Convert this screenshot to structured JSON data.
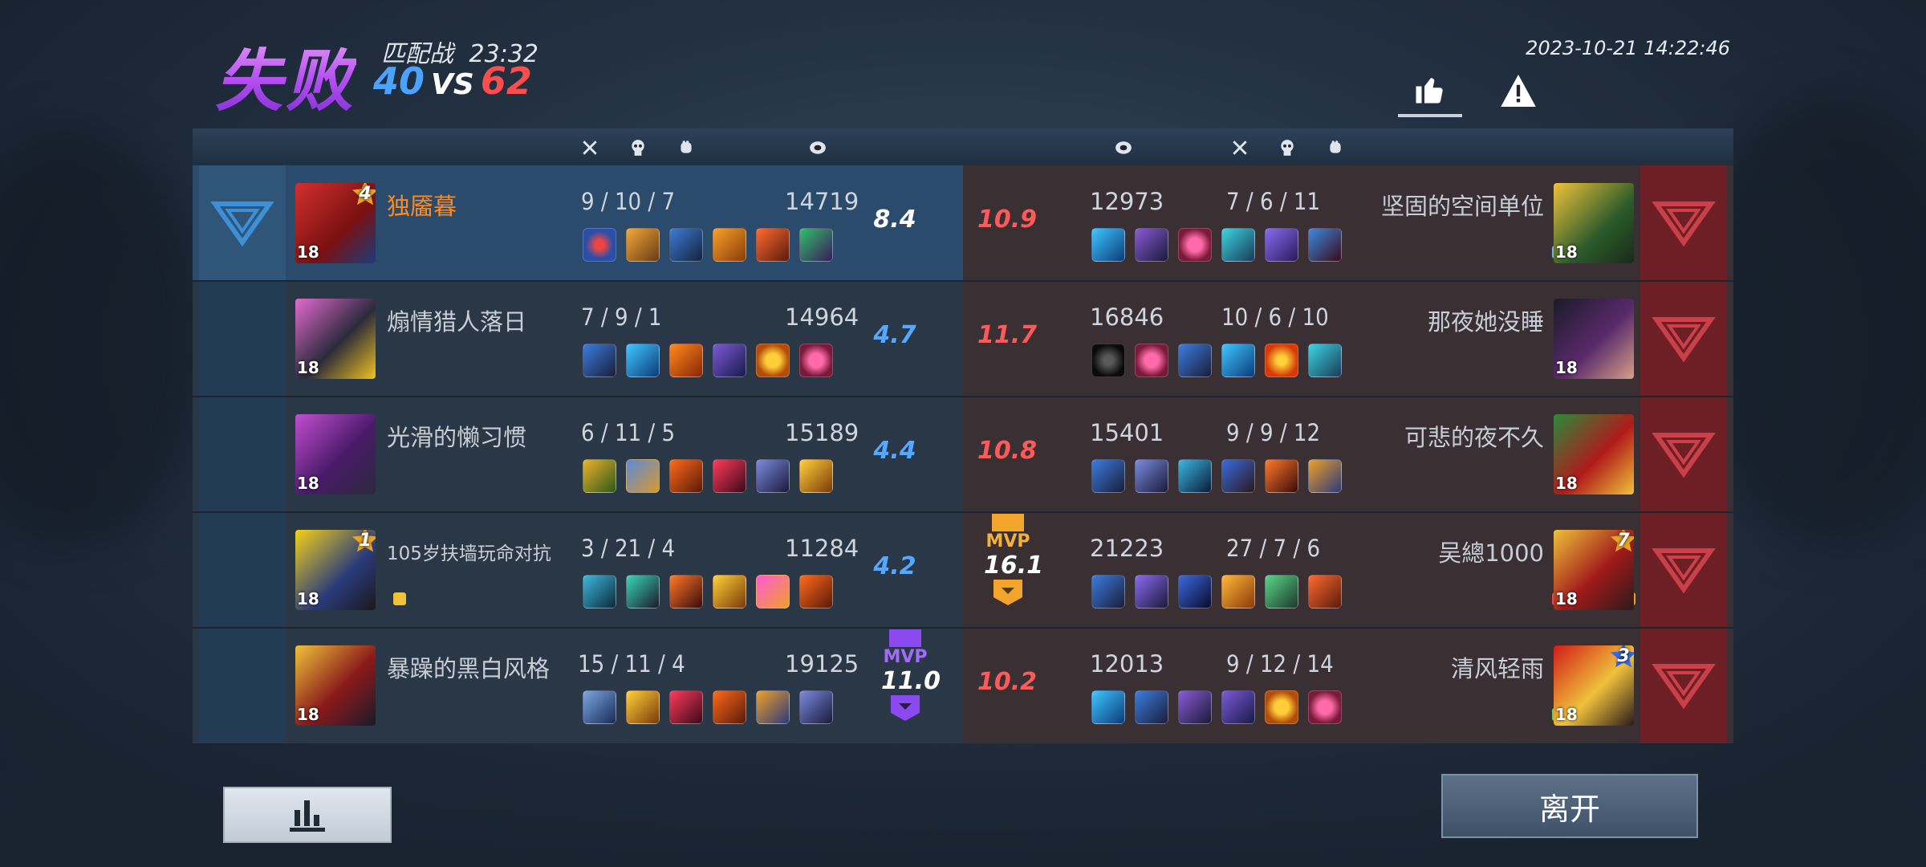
{
  "header": {
    "result": "失败",
    "mode": "匹配战",
    "duration": "23:32",
    "score_left": "40",
    "score_vs": "VS",
    "score_right": "62",
    "datetime": "2023-10-21 14:22:46"
  },
  "icons": {
    "like": "thumbs-up-icon",
    "report": "warning-icon",
    "kills": "crossed-swords-icon",
    "deaths": "skull-icon",
    "assists": "fist-icon",
    "damage": "coin-icon"
  },
  "colors": {
    "defeat": "#b44ef2",
    "blue_team": "#1e8ad6",
    "red_team": "#e3262a",
    "mvp_blue": "#8a4af0",
    "mvp_red": "#f2a52a"
  },
  "left_team": [
    {
      "name": "独靥暮",
      "level": "18",
      "badge": "4",
      "kda": "9 / 10 / 7",
      "damage": "14719",
      "rating": "8.4",
      "me": true
    },
    {
      "name": "煽情猎人落日",
      "level": "18",
      "badge": "",
      "kda": "7 / 9 / 1",
      "damage": "14964",
      "rating": "4.7"
    },
    {
      "name": "光滑的懒习惯",
      "level": "18",
      "badge": "",
      "kda": "6 / 11 / 5",
      "damage": "15189",
      "rating": "4.4"
    },
    {
      "name": "105岁扶墙玩命对抗",
      "level": "18",
      "badge": "1",
      "kda": "3 / 21 / 4",
      "damage": "11284",
      "rating": "4.2"
    },
    {
      "name": "暴躁的黑白风格",
      "level": "18",
      "badge": "",
      "kda": "15 / 11 / 4",
      "damage": "19125",
      "rating": "11.0",
      "mvp": "MVP"
    }
  ],
  "right_team": [
    {
      "name": "坚固的空间单位",
      "level": "18",
      "badge": "",
      "kda": "7 / 6 / 11",
      "damage": "12973",
      "rating": "10.9"
    },
    {
      "name": "那夜她没睡",
      "level": "18",
      "badge": "",
      "kda": "10 / 6 / 10",
      "damage": "16846",
      "rating": "11.7"
    },
    {
      "name": "可悲的夜不久",
      "level": "18",
      "badge": "",
      "kda": "9 / 9 / 12",
      "damage": "15401",
      "rating": "10.8"
    },
    {
      "name": "吴總1000",
      "level": "18",
      "badge": "7",
      "kda": "27 / 7 / 6",
      "damage": "21223",
      "rating": "16.1",
      "mvp": "MVP"
    },
    {
      "name": "清风轻雨",
      "level": "18",
      "badge": "3",
      "kda": "9 / 12 / 14",
      "damage": "12013",
      "rating": "10.2"
    }
  ],
  "buttons": {
    "stats": "bar-chart-icon",
    "leave": "离开"
  }
}
